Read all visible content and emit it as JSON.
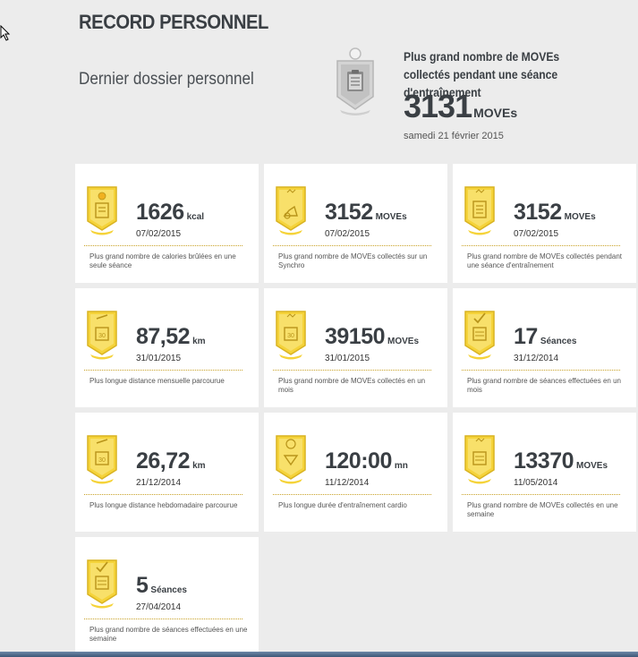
{
  "page": {
    "title": "RECORD PERSONNEL",
    "subtitle": "Dernier dossier personnel"
  },
  "hero": {
    "description": "Plus grand nombre de MOVEs collectés pendant une séance d'entraînement",
    "value": "3131",
    "unit": "MOVEs",
    "date": "samedi 21 février 2015",
    "icon": "clipboard-icon"
  },
  "colors": {
    "badge_yellow": "#f5d33a",
    "badge_dark": "#d9b321",
    "hero_badge_grey": "#c9c9c9",
    "card_bg": "#ffffff",
    "page_bg": "#ececec"
  },
  "records": [
    {
      "value": "1626",
      "unit": "kcal",
      "date": "07/02/2015",
      "description": "Plus grand nombre de calories brûlées en une seule séance",
      "icon": "flame-clipboard-icon"
    },
    {
      "value": "3152",
      "unit": "MOVEs",
      "date": "07/02/2015",
      "description": "Plus grand nombre de MOVEs collectés sur un Synchro",
      "icon": "bike-icon"
    },
    {
      "value": "3152",
      "unit": "MOVEs",
      "date": "07/02/2015",
      "description": "Plus grand nombre de MOVEs collectés pendant une séance d'entraînement",
      "icon": "clipboard-icon"
    },
    {
      "value": "87,52",
      "unit": "km",
      "date": "31/01/2015",
      "description": "Plus longue distance mensuelle parcourue",
      "icon": "runner-calendar-icon"
    },
    {
      "value": "39150",
      "unit": "MOVEs",
      "date": "31/01/2015",
      "description": "Plus grand nombre de MOVEs collectés en un mois",
      "icon": "calendar-30-icon"
    },
    {
      "value": "17",
      "unit": "Séances",
      "date": "31/12/2014",
      "description": "Plus grand nombre de séances effectuées en un mois",
      "icon": "check-calendar-icon"
    },
    {
      "value": "26,72",
      "unit": "km",
      "date": "21/12/2014",
      "description": "Plus longue distance hebdomadaire parcourue",
      "icon": "runner-calendar-icon"
    },
    {
      "value": "120:00",
      "unit": "mn",
      "date": "11/12/2014",
      "description": "Plus longue durée d'entraînement cardio",
      "icon": "heart-timer-icon"
    },
    {
      "value": "13370",
      "unit": "MOVEs",
      "date": "11/05/2014",
      "description": "Plus grand nombre de MOVEs collectés en une semaine",
      "icon": "calendar-week-icon"
    },
    {
      "value": "5",
      "unit": "Séances",
      "date": "27/04/2014",
      "description": "Plus grand nombre de séances effectuées en une semaine",
      "icon": "check-calendar-icon"
    }
  ]
}
